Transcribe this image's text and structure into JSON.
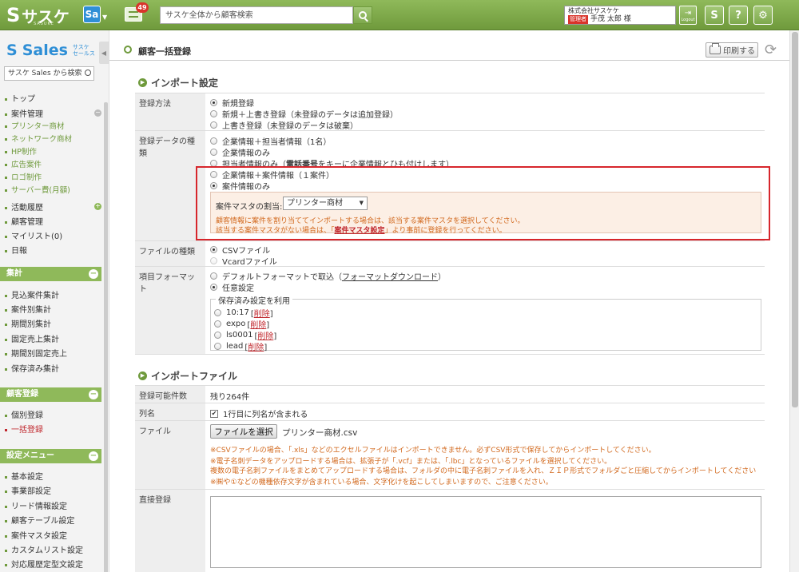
{
  "topbar": {
    "logo": "サスケ",
    "logo_sub": "SASUKE",
    "app_switch": "Sa",
    "message_count": "49",
    "search_placeholder": "サスケ全体から顧客検索",
    "company": "株式会社サスケケ",
    "role": "管理者",
    "user_name": "手茂 太郎 様",
    "logout_label": "Logout",
    "help_label": "?",
    "colors": {
      "green": "#7ea94d",
      "blue": "#2f8fd6",
      "red": "#d9342b"
    }
  },
  "sidebar": {
    "logo": "Sales",
    "logo_tag_1": "サスケ",
    "logo_tag_2": "セールス",
    "search_placeholder": "サスケ Sales から検索",
    "items": [
      {
        "label": "トップ"
      },
      {
        "label": "案件管理"
      },
      {
        "label": "プリンター商材"
      },
      {
        "label": "ネットワーク商材"
      },
      {
        "label": "HP制作"
      },
      {
        "label": "広告案件"
      },
      {
        "label": "ロゴ制作"
      },
      {
        "label": "サーバー費(月額)"
      },
      {
        "label": "活動履歴"
      },
      {
        "label": "顧客管理"
      },
      {
        "label": "マイリスト(0)"
      },
      {
        "label": "日報"
      }
    ],
    "sec_aggregate": "集計",
    "aggregate_items": [
      "見込案件集計",
      "案件別集計",
      "期間別集計",
      "固定売上集計",
      "期間別固定売上",
      "保存済み集計"
    ],
    "sec_register": "顧客登録",
    "register_items": [
      "個別登録",
      "一括登録"
    ],
    "sec_settings": "設定メニュー",
    "settings_items": [
      "基本設定",
      "事業部設定",
      "リード情報設定",
      "顧客テーブル設定",
      "案件マスタ設定",
      "カスタムリスト設定",
      "対応履歴定型文設定"
    ]
  },
  "main": {
    "page_title": "顧客一括登録",
    "print_label": "印刷する",
    "import_settings": {
      "title": "インポート設定",
      "method_label": "登録方法",
      "method_options": [
        "新規登録",
        "新規＋上書き登録（未登録のデータは追加登録）",
        "上書き登録（未登録のデータは破棄）"
      ],
      "type_label": "登録データの種類",
      "type_options": [
        "企業情報＋担当者情報（1名）",
        "企業情報のみ",
        "担当者情報のみ（電話番号をキーに企業情報とひも付けします）",
        "企業情報＋案件情報（１案件）",
        "案件情報のみ"
      ],
      "type_opt3_pre": "担当者情報のみ（",
      "type_opt3_bold": "電話番号",
      "type_opt3_post": "をキーに企業情報とひも付けします）",
      "assign_label": "案件マスタの割当:",
      "assign_value": "プリンター商材",
      "assign_note1": "顧客情報に案件を割り当ててインポートする場合は、該当する案件マスタを選択してください。",
      "assign_note2_pre": "該当する案件マスタがない場合は、「",
      "assign_note2_link": "案件マスタ設定",
      "assign_note2_post": "」より事前に登録を行ってください。",
      "file_type_label": "ファイルの種類",
      "file_type_options": [
        "CSVファイル",
        "Vcardファイル"
      ],
      "format_label": "項目フォーマット",
      "format_opt1_pre": "デフォルトフォーマットで取込（",
      "format_opt1_link": "フォーマットダウンロード",
      "format_opt1_post": "）",
      "format_opt2": "任意設定",
      "saved_legend": "保存済み設定を利用",
      "saved_items": [
        {
          "name": "10:17",
          "delete": "削除"
        },
        {
          "name": "expo",
          "delete": "削除"
        },
        {
          "name": "ls0001",
          "delete": "削除"
        },
        {
          "name": "lead",
          "delete": "削除"
        }
      ]
    },
    "import_file": {
      "title": "インポートファイル",
      "count_label": "登録可能件数",
      "count_value": "残り264件",
      "column_label": "列名",
      "column_check": "1行目に列名が含まれる",
      "file_label": "ファイル",
      "file_button": "ファイルを選択",
      "file_name": "プリンター商材.csv",
      "note1": "※CSVファイルの場合、「.xls」などのエクセルファイルはインポートできません。必ずCSV形式で保存してからインポートしてください。",
      "note2": "※電子名刺データをアップロードする場合は、拡張子が「.vcf」または、「.lbc」となっているファイルを選択してください。",
      "note3": "複数の電子名刺ファイルをまとめてアップロードする場合は、フォルダの中に電子名刺ファイルを入れ、ＺＩＰ形式でフォルダごと圧縮してからインポートしてください",
      "note4": "※㈱や①などの機種依存文字が含まれている場合、文字化けを起こしてしまいますので、ご注意ください。",
      "direct_label": "直接登録"
    }
  }
}
